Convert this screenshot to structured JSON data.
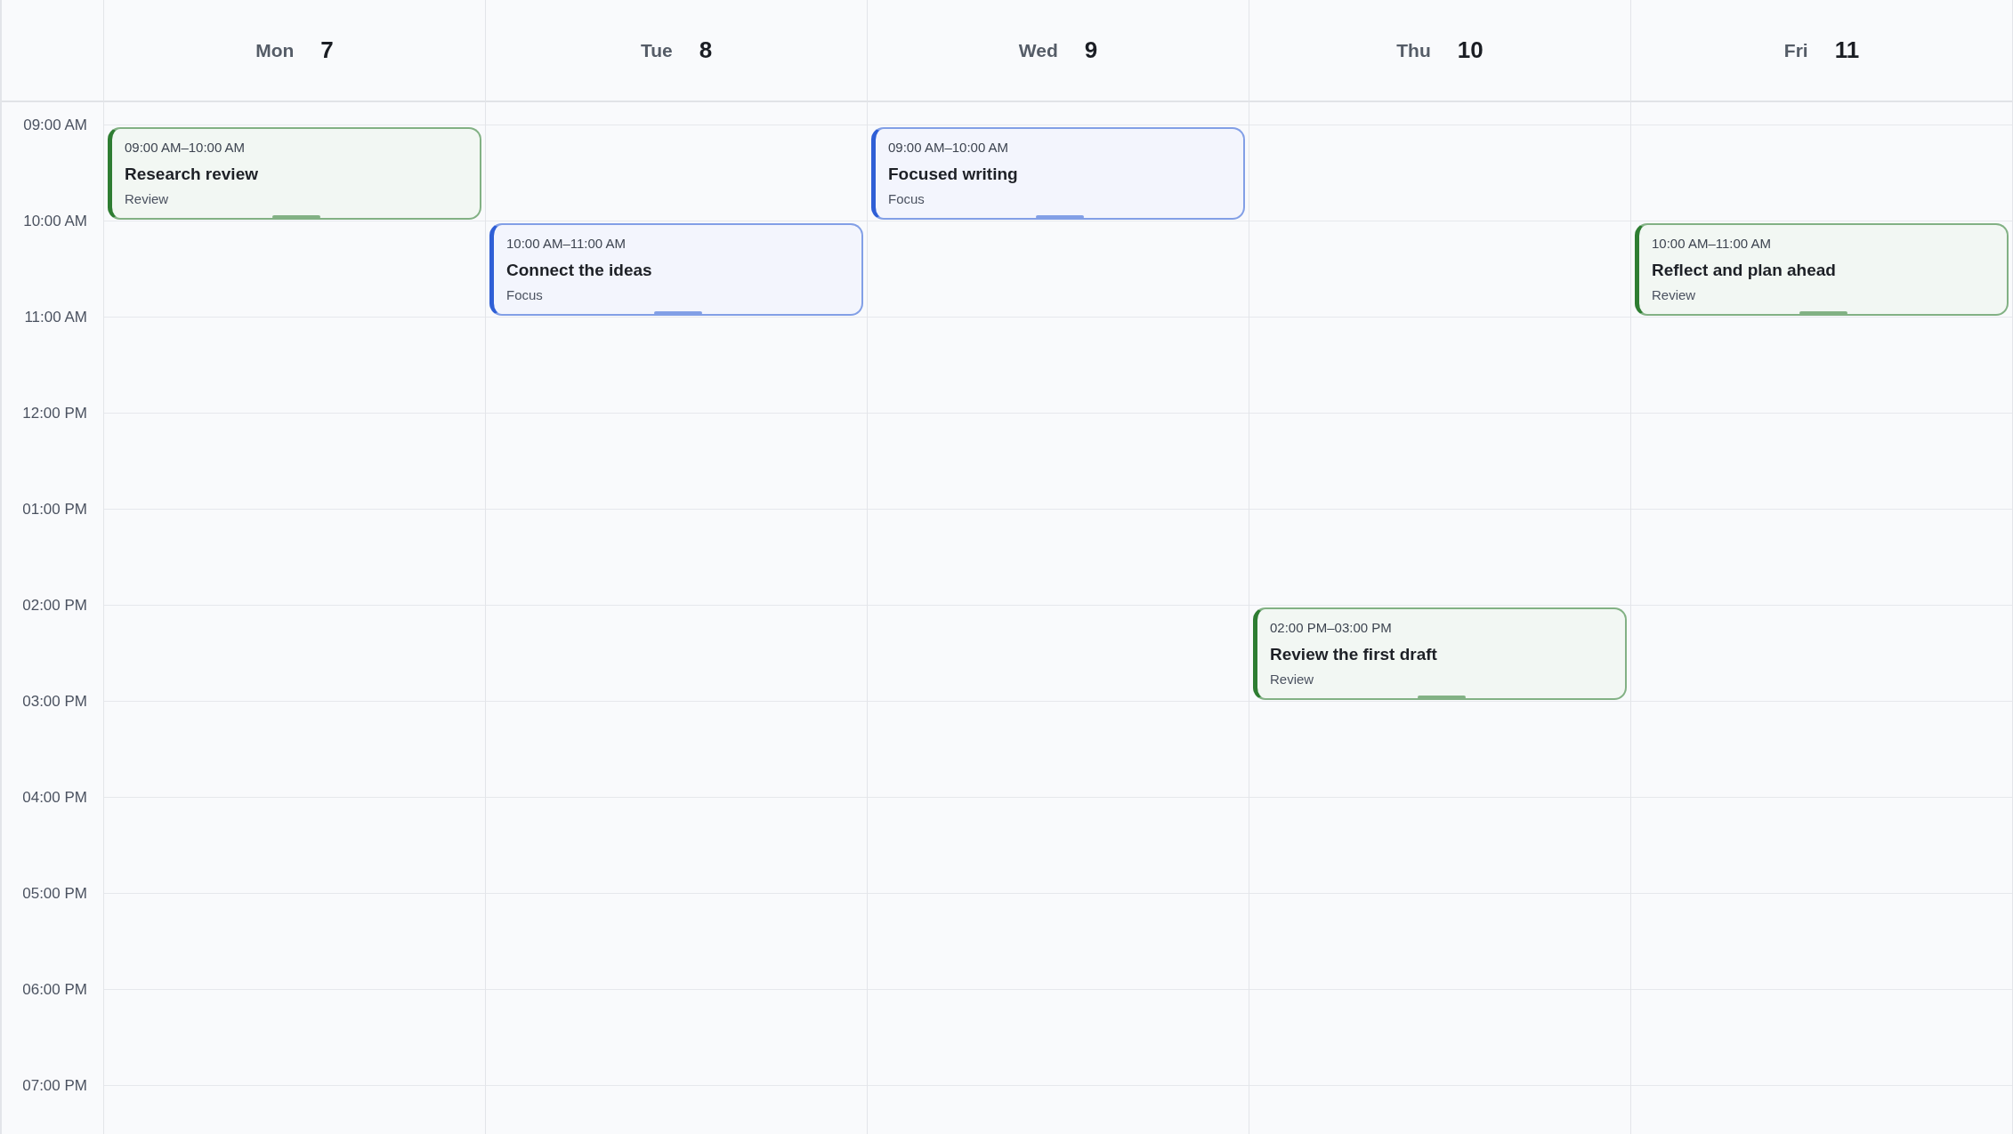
{
  "days": [
    {
      "weekday": "Mon",
      "date": "7",
      "events": [
        {
          "time": "09:00 AM–10:00 AM",
          "title": "Research review",
          "category": "Review",
          "color": "#2e7d32"
        }
      ]
    },
    {
      "weekday": "Tue",
      "date": "8",
      "events": [
        {
          "time": "10:00 AM–11:00 AM",
          "title": "Connect the ideas",
          "category": "Focus",
          "color": "#2f5fd6"
        }
      ]
    },
    {
      "weekday": "Wed",
      "date": "9",
      "events": [
        {
          "time": "09:00 AM–10:00 AM",
          "title": "Focused writing",
          "category": "Focus",
          "color": "#2f5fd6"
        }
      ]
    },
    {
      "weekday": "Thu",
      "date": "10",
      "events": [
        {
          "time": "02:00 PM–03:00 PM",
          "title": "Review the first draft",
          "category": "Review",
          "color": "#2e7d32"
        }
      ]
    },
    {
      "weekday": "Fri",
      "date": "11",
      "events": [
        {
          "time": "10:00 AM–11:00 AM",
          "title": "Reflect and plan ahead",
          "category": "Review",
          "color": "#2e7d32"
        }
      ]
    }
  ],
  "time_labels": [
    "09:00 AM",
    "10:00 AM",
    "11:00 AM",
    "12:00 PM",
    "01:00 PM",
    "02:00 PM",
    "03:00 PM",
    "04:00 PM",
    "05:00 PM",
    "06:00 PM",
    "07:00 PM"
  ]
}
